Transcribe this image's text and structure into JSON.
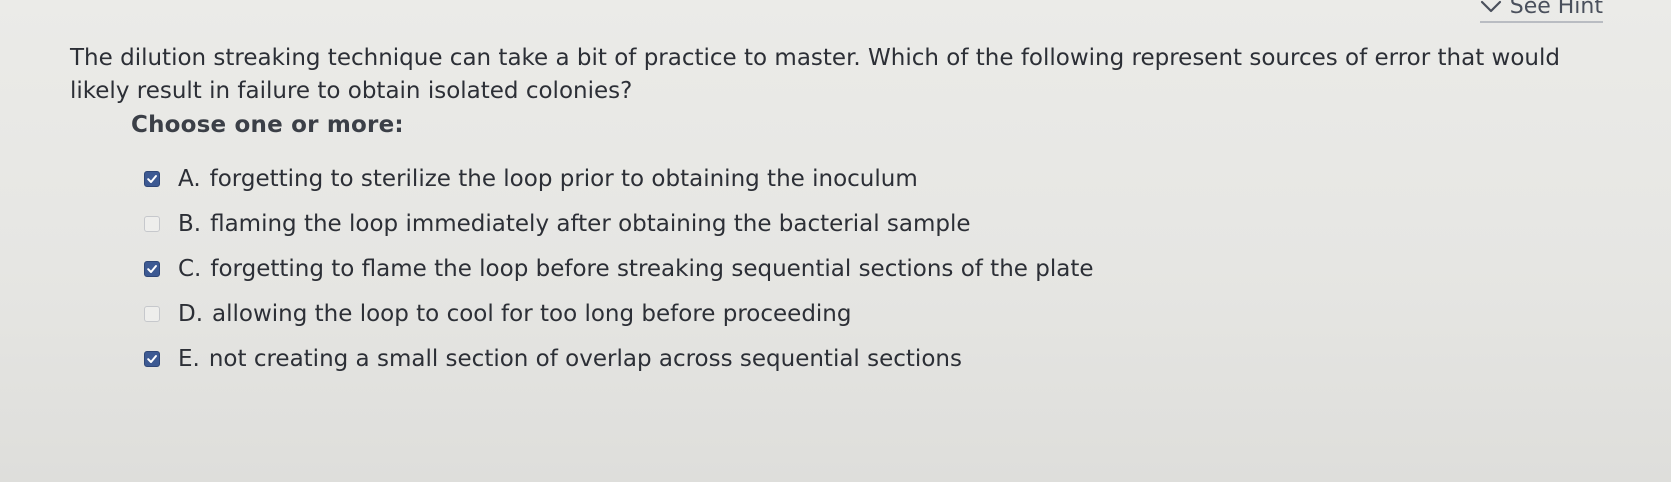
{
  "hint": {
    "label": "See Hint",
    "icon": "chevron-down-icon"
  },
  "question": {
    "text": "The dilution streaking technique can take a bit of practice to master. Which of the following represent sources of error that would likely result in failure to obtain isolated colonies?",
    "prompt": "Choose one or more:"
  },
  "options": [
    {
      "letter": "A.",
      "text": "forgetting to sterilize the loop prior to obtaining the inoculum",
      "checked": true
    },
    {
      "letter": "B.",
      "text": "flaming the loop immediately after obtaining the bacterial sample",
      "checked": false
    },
    {
      "letter": "C.",
      "text": "forgetting to flame the loop before streaking sequential sections of the plate",
      "checked": true
    },
    {
      "letter": "D.",
      "text": "allowing the loop to cool for too long before proceeding",
      "checked": false
    },
    {
      "letter": "E.",
      "text": "not creating a small section of overlap across sequential sections",
      "checked": true
    }
  ],
  "colors": {
    "checked_fill": "#3d5a93",
    "unchecked_fill": "#eeeeec",
    "text": "#2c2f36"
  }
}
